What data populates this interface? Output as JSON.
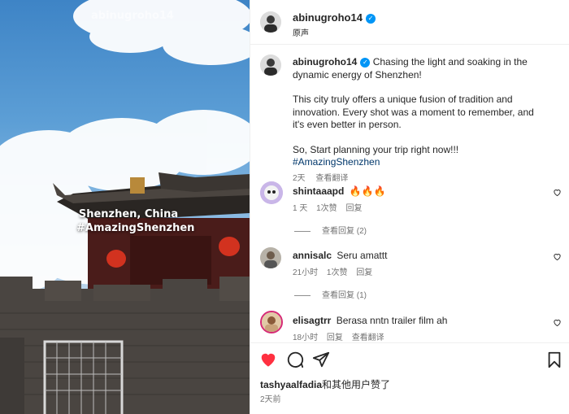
{
  "photo": {
    "watermark": "abinugroho14",
    "overlay_line1": "Shenzhen, China",
    "overlay_line2": "#AmazingShenzhen"
  },
  "header": {
    "username": "abinugroho14",
    "subtitle": "原声"
  },
  "caption": {
    "username": "abinugroho14",
    "line1": "Chasing the light and soaking in the dynamic energy of Shenzhen!",
    "paragraph2": "This city truly offers a unique fusion of tradition and innovation. Every shot was a moment to remember, and it's even better in person.",
    "paragraph3_text": "So, Start planning your trip right now!!! ",
    "hashtag": "#AmazingShenzhen",
    "time": "2天",
    "translate": "查看翻译"
  },
  "comments": [
    {
      "username": "shintaaapd",
      "text": "🔥🔥🔥",
      "time": "1 天",
      "likes": "1次赞",
      "reply": "回复",
      "view_replies": "查看回复 (2)"
    },
    {
      "username": "annisalc",
      "text": "Seru amattt",
      "time": "21小时",
      "likes": "1次赞",
      "reply": "回复",
      "view_replies": "查看回复 (1)"
    },
    {
      "username": "elisagtrr",
      "text": "Berasa nntn trailer film ah",
      "time": "18小时",
      "reply": "回复",
      "translate": "查看翻译"
    }
  ],
  "actions": {
    "liked_by_user": "tashyaalfadia",
    "liked_by_suffix": "和其他用户赞了",
    "post_time": "2天前"
  },
  "colors": {
    "like_red": "#ff3040",
    "verified_blue": "#0095f6",
    "hashtag_blue": "#00376b",
    "muted": "#737373"
  }
}
